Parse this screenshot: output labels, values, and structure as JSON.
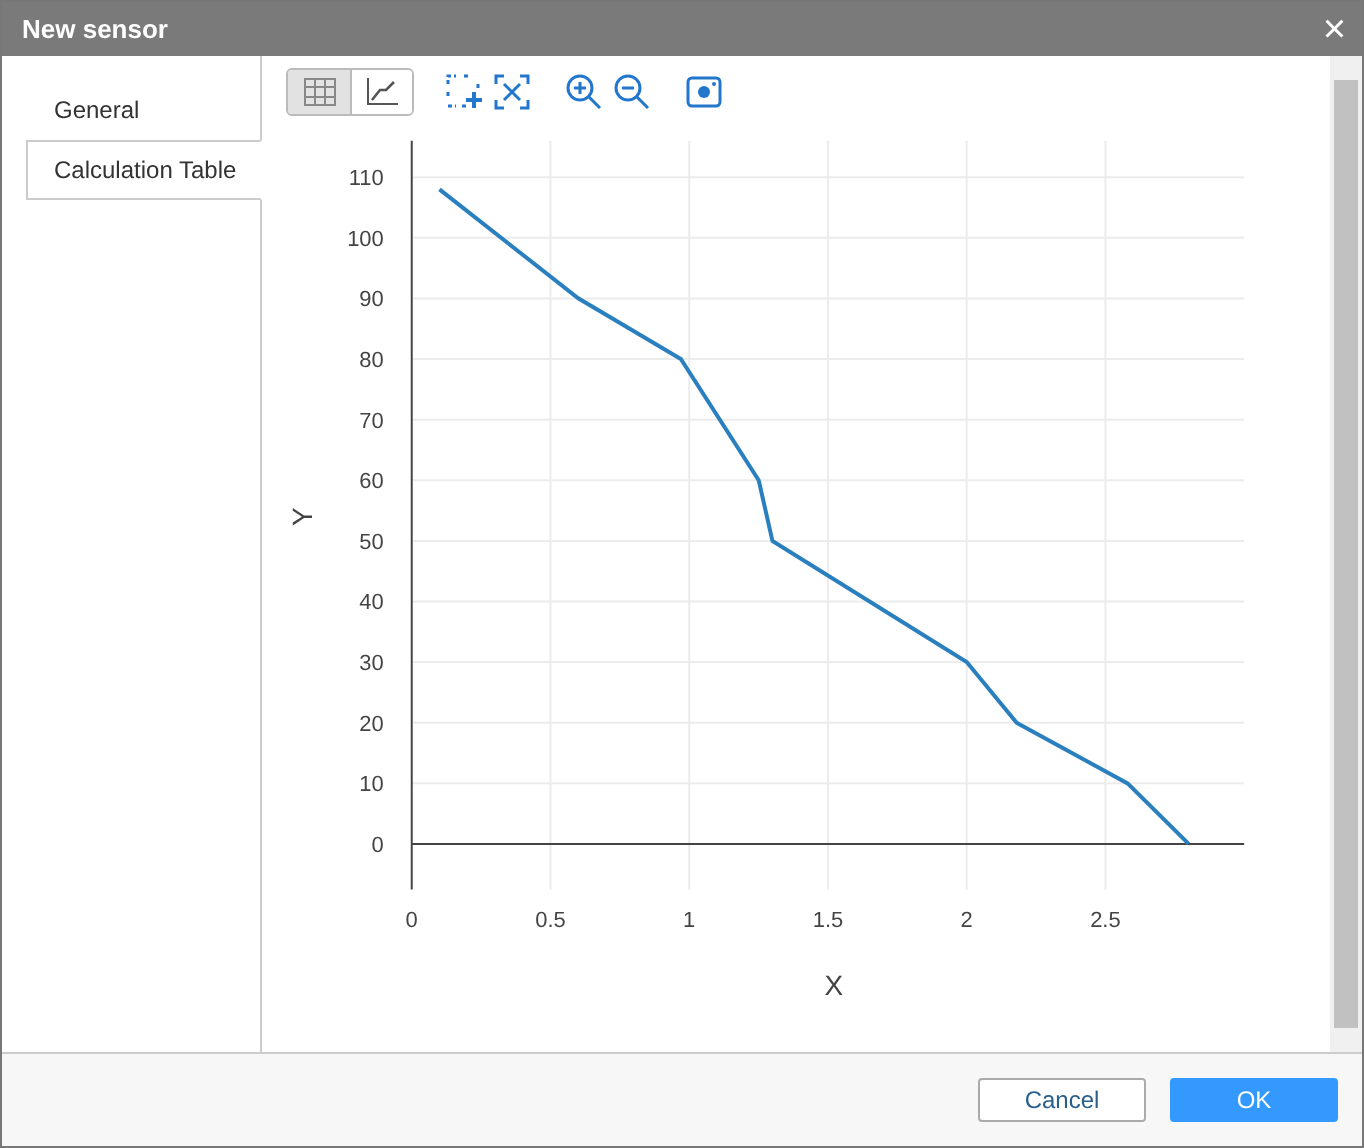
{
  "window": {
    "title": "New sensor",
    "close": "×"
  },
  "tabs": [
    {
      "label": "General",
      "selected": false
    },
    {
      "label": "Calculation Table",
      "selected": true
    }
  ],
  "view_toggle": [
    {
      "kind": "table",
      "selected": true
    },
    {
      "kind": "chart",
      "selected": false
    }
  ],
  "chart": {
    "chart_data": {
      "type": "line",
      "xlabel": "X",
      "ylabel": "Y",
      "xlim": [
        0,
        3
      ],
      "ylim": [
        -7.5,
        116
      ],
      "xticks": [
        {
          "value": 0,
          "label": "0"
        },
        {
          "value": 0.5,
          "label": "0.5"
        },
        {
          "value": 1,
          "label": "1"
        },
        {
          "value": 1.5,
          "label": "1.5"
        },
        {
          "value": 2,
          "label": "2"
        },
        {
          "value": 2.5,
          "label": "2.5"
        }
      ],
      "yticks": [
        0,
        10,
        20,
        30,
        40,
        50,
        60,
        70,
        80,
        90,
        100,
        110
      ],
      "x": [
        0.1,
        0.6,
        0.97,
        1.25,
        1.3,
        2,
        2.18,
        2.58,
        2.8
      ],
      "grid": true,
      "series": [
        {
          "color": "#2a7fbf",
          "values": [
            108,
            90,
            80,
            60,
            50,
            30,
            20,
            10,
            0
          ]
        }
      ]
    }
  },
  "buttons": [
    {
      "label": "Cancel",
      "kind": "secondary"
    },
    {
      "label": "OK",
      "kind": "primary"
    }
  ]
}
